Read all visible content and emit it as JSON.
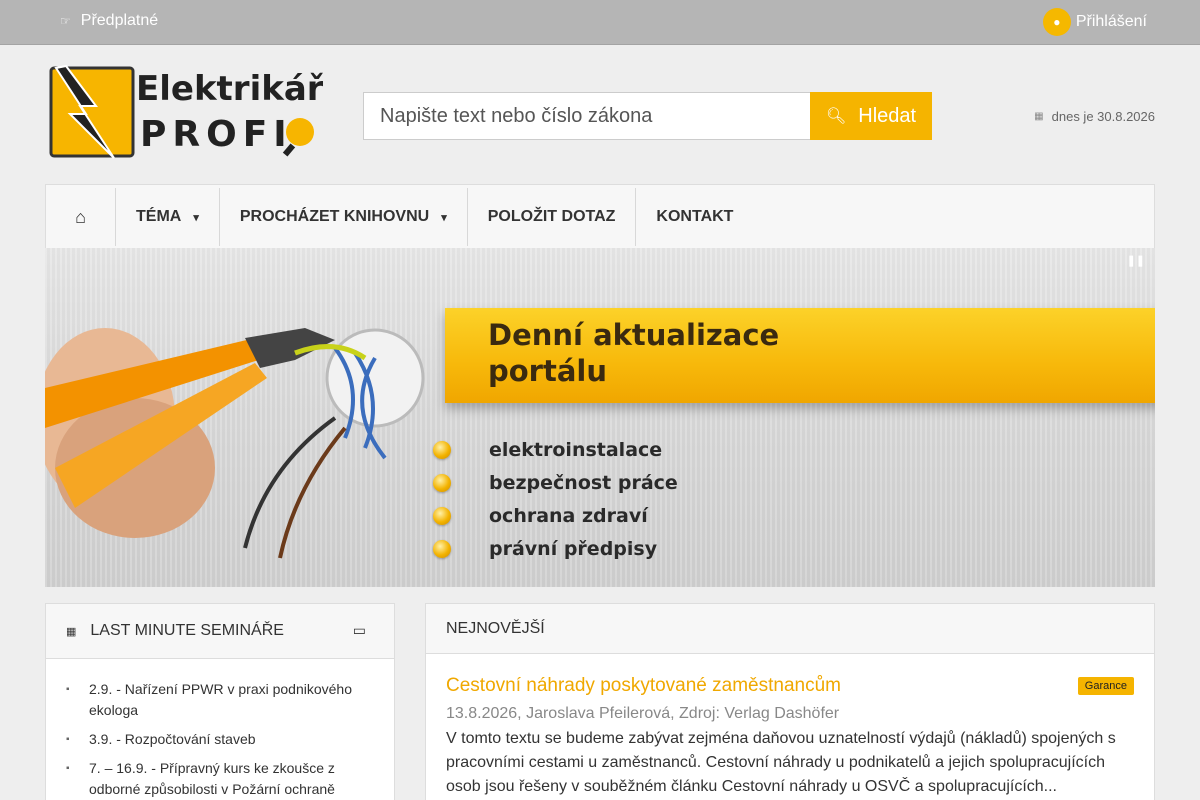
{
  "topbar": {
    "subscription_icon": "hand-icon",
    "subscription_label": "Předplatné",
    "login_icon": "user-icon",
    "login_label": "Přihlášení"
  },
  "header": {
    "logo_line1": "Elektrikář",
    "logo_line2": "PROFI",
    "search_placeholder": "Napište text nebo číslo zákona",
    "search_button": "Hledat",
    "date_text": "dnes je 30.8.2026"
  },
  "nav": {
    "home_icon": "home-icon",
    "items": [
      {
        "label": "TÉMA",
        "dropdown": true
      },
      {
        "label": "PROCHÁZET KNIHOVNU",
        "dropdown": true
      },
      {
        "label": "POLOŽIT DOTAZ",
        "dropdown": false
      },
      {
        "label": "KONTAKT",
        "dropdown": false
      }
    ]
  },
  "banner": {
    "title_line1": "Denní aktualizace",
    "title_line2": "portálu",
    "bullets": [
      "elektroinstalace",
      "bezpečnost práce",
      "ochrana zdraví",
      "právní předpisy"
    ],
    "accent_color": "#f5b400"
  },
  "seminars": {
    "title": "LAST MINUTE SEMINÁŘE",
    "items": [
      "2.9. - Nařízení PPWR v praxi podnikového ekologa",
      "3.9. - Rozpočtování staveb",
      "7. – 16.9. - Přípravný kurs ke zkoušce z odborné způsobilosti v Požární ochraně"
    ]
  },
  "newest": {
    "title": "NEJNOVĚJŠÍ",
    "article": {
      "title": "Cestovní náhrady poskytované zaměstnancům",
      "badge": "Garance",
      "meta": "13.8.2026, Jaroslava Pfeilerová, Zdroj: Verlag Dashöfer",
      "text": "V tomto textu se budeme zabývat zejména daňovou uznatelností výdajů (nákladů) spojených s pracovními cestami u zaměstnanců. Cestovní náhrady u podnikatelů a jejich spolupracujících osob jsou řešeny v souběžném článku  Cestovní náhrady u OSVČ a spolupracujících..."
    }
  },
  "colors": {
    "brand_yellow": "#f5b400",
    "topbar_gray": "#b5b5b5"
  }
}
